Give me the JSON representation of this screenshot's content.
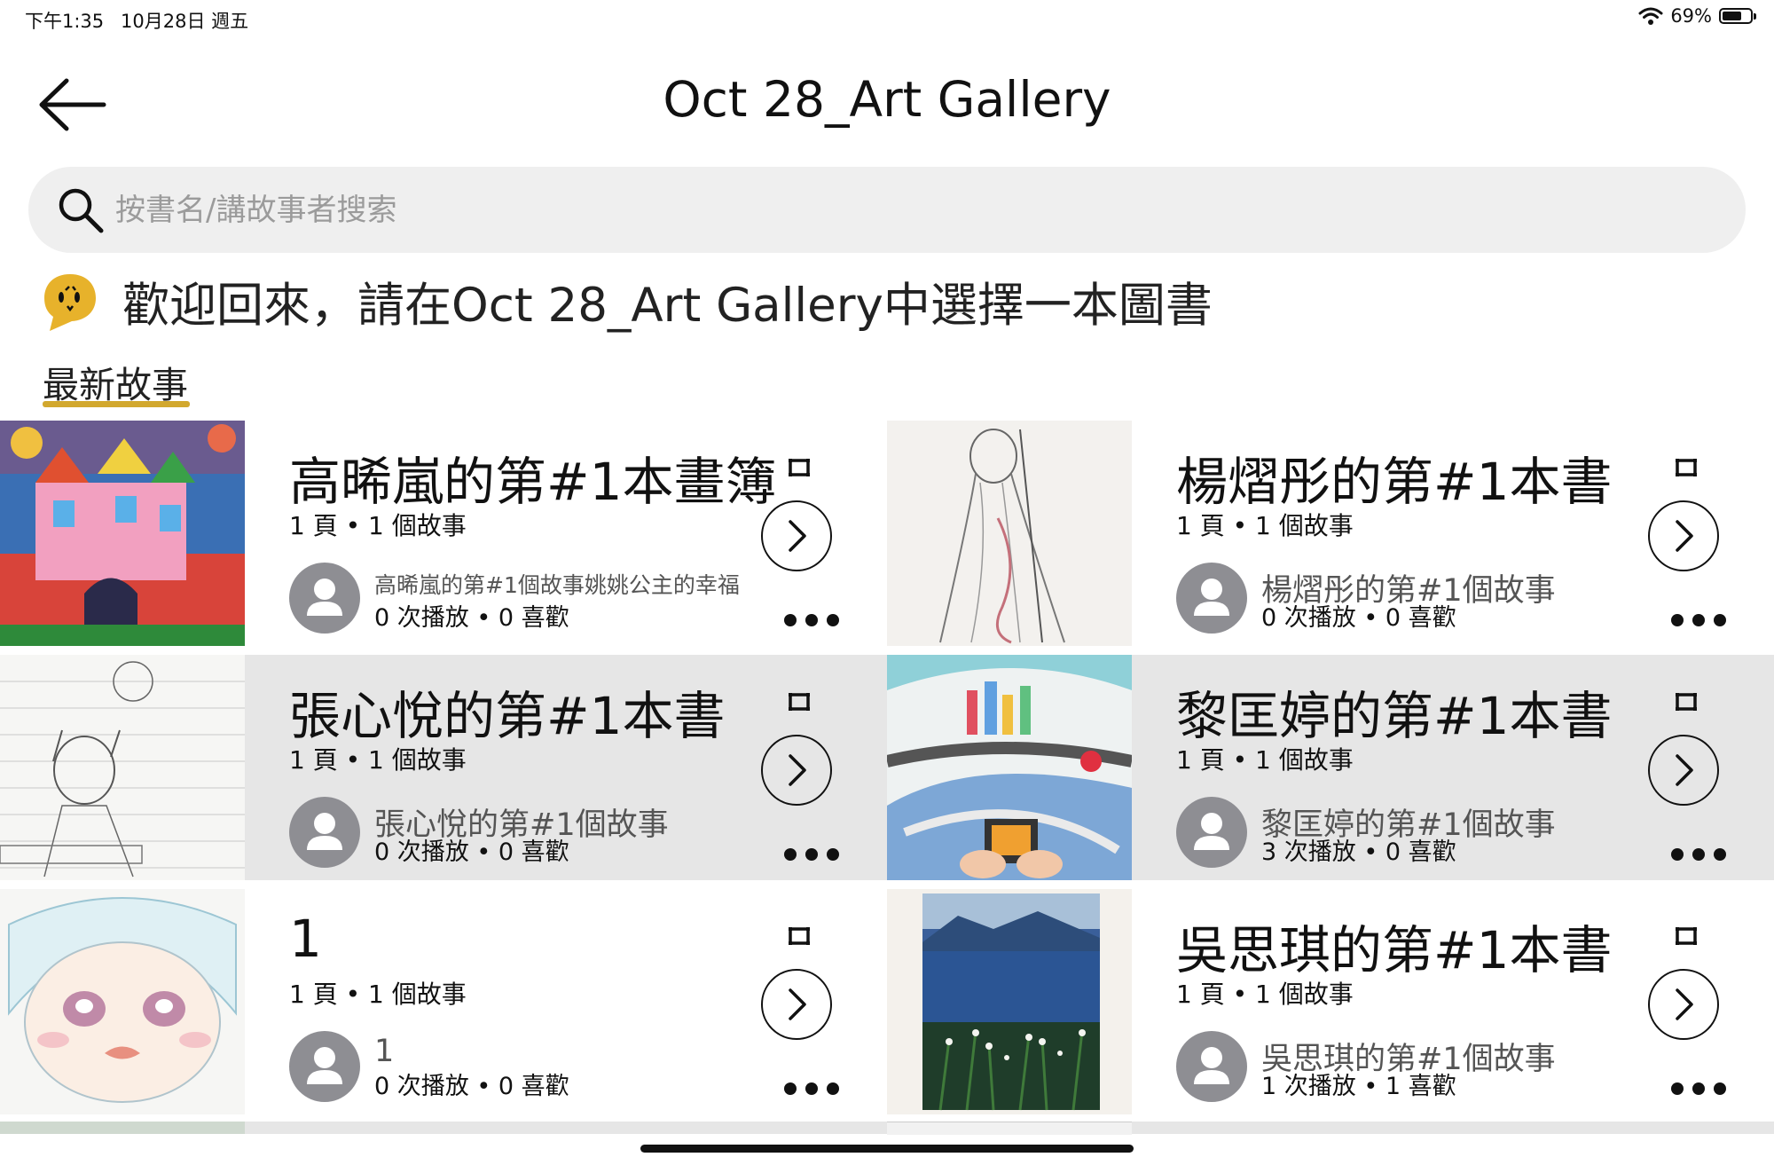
{
  "status_bar": {
    "time": "下午1:35",
    "date": "10月28日 週五",
    "battery": "69%",
    "battery_level": 0.69
  },
  "header": {
    "title": "Oct 28_Art Gallery",
    "back_icon": "back-arrow-icon"
  },
  "search": {
    "placeholder": "按書名/講故事者搜索",
    "value": ""
  },
  "welcome": {
    "text": "歡迎回來，請在Oct 28_Art Gallery中選擇一本圖書"
  },
  "tabs": [
    {
      "label": "最新故事",
      "active": true
    }
  ],
  "accent_color": "#d2a82e",
  "books": [
    {
      "title": "高晞嵐的第#1本畫簿",
      "meta": "1 頁 • 1 個故事",
      "story": "高晞嵐的第#1個故事姚姚公主的幸福",
      "stats": "0 次播放 • 0 喜歡",
      "thumb": "castle-drawing"
    },
    {
      "title": "楊熠彤的第#1本書",
      "meta": "1 頁 • 1 個故事",
      "story": "楊熠彤的第#1個故事",
      "stats": "0 次播放 • 0 喜歡",
      "thumb": "pencil-figure-sketch"
    },
    {
      "title": "張心悅的第#1本書",
      "meta": "1 頁 • 1 個故事",
      "story": "張心悅的第#1個故事",
      "stats": "0 次播放 • 0 喜歡",
      "thumb": "lined-paper-sketch"
    },
    {
      "title": "黎匡婷的第#1本書",
      "meta": "1 頁 • 1 個故事",
      "story": "黎匡婷的第#1個故事",
      "stats": "3 次播放 • 0 喜歡",
      "thumb": "city-map-drawing"
    },
    {
      "title": "1",
      "meta": "1 頁 • 1 個故事",
      "story": "1",
      "stats": "0 次播放 • 0 喜歡",
      "thumb": "anime-face-drawing"
    },
    {
      "title": "吳思琪的第#1本書",
      "meta": "1 頁 • 1 個故事",
      "story": "吳思琪的第#1個故事",
      "stats": "1 次播放 • 1 喜歡",
      "thumb": "lake-landscape-painting"
    }
  ]
}
